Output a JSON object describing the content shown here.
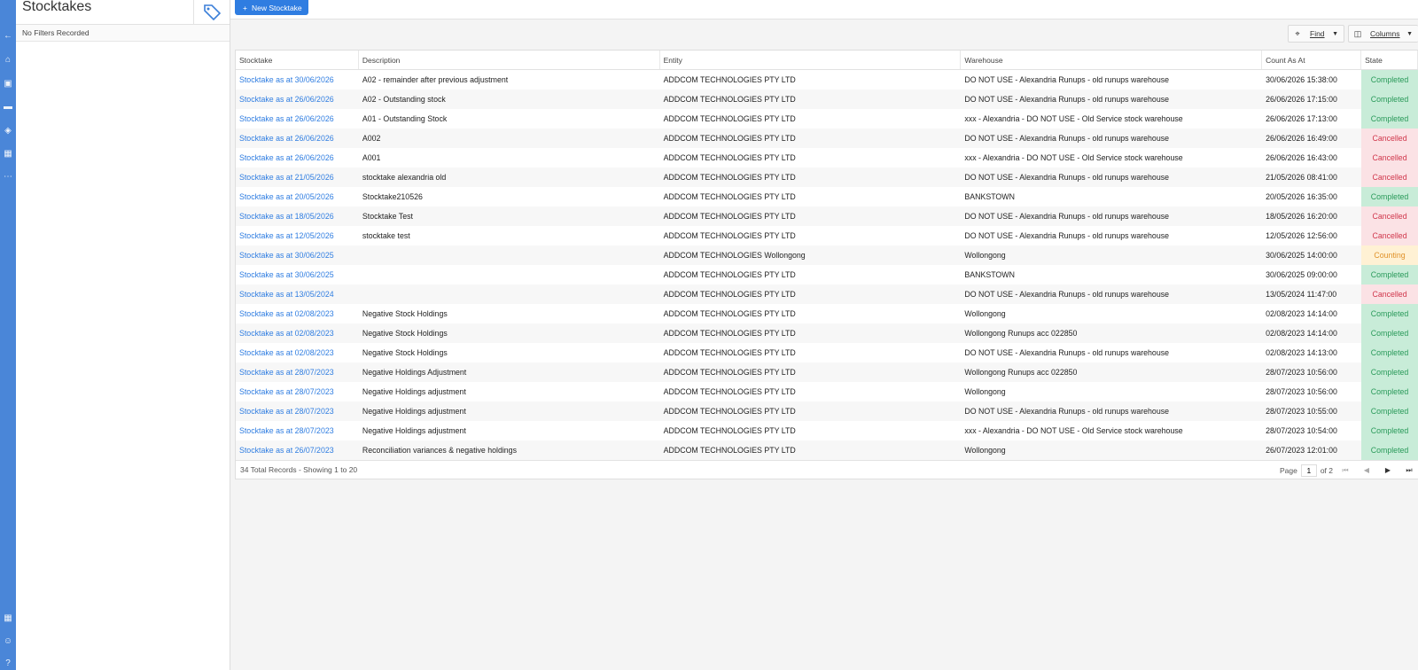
{
  "sidebar_panel": {
    "title": "Stocktakes",
    "filters_text": "No Filters Recorded"
  },
  "toolbar": {
    "new_button_label": "New Stocktake",
    "find_label": "Find",
    "columns_label": "Columns"
  },
  "table": {
    "columns": [
      "Stocktake",
      "Description",
      "Entity",
      "Warehouse",
      "Count As At",
      "State"
    ],
    "rows": [
      {
        "stocktake": "Stocktake as at 30/06/2026",
        "description": "A02 - remainder after previous adjustment",
        "entity": "ADDCOM TECHNOLOGIES PTY LTD",
        "warehouse": "DO NOT USE - Alexandria Runups - old runups warehouse",
        "count_as_at": "30/06/2026 15:38:00",
        "state": "Completed"
      },
      {
        "stocktake": "Stocktake as at 26/06/2026",
        "description": "A02 - Outstanding stock",
        "entity": "ADDCOM TECHNOLOGIES PTY LTD",
        "warehouse": "DO NOT USE - Alexandria Runups - old runups warehouse",
        "count_as_at": "26/06/2026 17:15:00",
        "state": "Completed"
      },
      {
        "stocktake": "Stocktake as at 26/06/2026",
        "description": "A01 - Outstanding Stock",
        "entity": "ADDCOM TECHNOLOGIES PTY LTD",
        "warehouse": "xxx - Alexandria - DO NOT USE - Old Service stock warehouse",
        "count_as_at": "26/06/2026 17:13:00",
        "state": "Completed"
      },
      {
        "stocktake": "Stocktake as at 26/06/2026",
        "description": "A002",
        "entity": "ADDCOM TECHNOLOGIES PTY LTD",
        "warehouse": "DO NOT USE - Alexandria Runups - old runups warehouse",
        "count_as_at": "26/06/2026 16:49:00",
        "state": "Cancelled"
      },
      {
        "stocktake": "Stocktake as at 26/06/2026",
        "description": "A001",
        "entity": "ADDCOM TECHNOLOGIES PTY LTD",
        "warehouse": "xxx - Alexandria - DO NOT USE - Old Service stock warehouse",
        "count_as_at": "26/06/2026 16:43:00",
        "state": "Cancelled"
      },
      {
        "stocktake": "Stocktake as at 21/05/2026",
        "description": "stocktake alexandria old",
        "entity": "ADDCOM TECHNOLOGIES PTY LTD",
        "warehouse": "DO NOT USE - Alexandria Runups - old runups warehouse",
        "count_as_at": "21/05/2026 08:41:00",
        "state": "Cancelled"
      },
      {
        "stocktake": "Stocktake as at 20/05/2026",
        "description": "Stocktake210526",
        "entity": "ADDCOM TECHNOLOGIES PTY LTD",
        "warehouse": "BANKSTOWN",
        "count_as_at": "20/05/2026 16:35:00",
        "state": "Completed"
      },
      {
        "stocktake": "Stocktake as at 18/05/2026",
        "description": "Stocktake Test",
        "entity": "ADDCOM TECHNOLOGIES PTY LTD",
        "warehouse": "DO NOT USE - Alexandria Runups - old runups warehouse",
        "count_as_at": "18/05/2026 16:20:00",
        "state": "Cancelled"
      },
      {
        "stocktake": "Stocktake as at 12/05/2026",
        "description": "stocktake test",
        "entity": "ADDCOM TECHNOLOGIES PTY LTD",
        "warehouse": "DO NOT USE - Alexandria Runups - old runups warehouse",
        "count_as_at": "12/05/2026 12:56:00",
        "state": "Cancelled"
      },
      {
        "stocktake": "Stocktake as at 30/06/2025",
        "description": "",
        "entity": "ADDCOM TECHNOLOGIES Wollongong",
        "warehouse": "Wollongong",
        "count_as_at": "30/06/2025 14:00:00",
        "state": "Counting"
      },
      {
        "stocktake": "Stocktake as at 30/06/2025",
        "description": "",
        "entity": "ADDCOM TECHNOLOGIES PTY LTD",
        "warehouse": "BANKSTOWN",
        "count_as_at": "30/06/2025 09:00:00",
        "state": "Completed"
      },
      {
        "stocktake": "Stocktake as at 13/05/2024",
        "description": "",
        "entity": "ADDCOM TECHNOLOGIES PTY LTD",
        "warehouse": "DO NOT USE - Alexandria Runups - old runups warehouse",
        "count_as_at": "13/05/2024 11:47:00",
        "state": "Cancelled"
      },
      {
        "stocktake": "Stocktake as at 02/08/2023",
        "description": "Negative Stock Holdings",
        "entity": "ADDCOM TECHNOLOGIES PTY LTD",
        "warehouse": "Wollongong",
        "count_as_at": "02/08/2023 14:14:00",
        "state": "Completed"
      },
      {
        "stocktake": "Stocktake as at 02/08/2023",
        "description": "Negative Stock Holdings",
        "entity": "ADDCOM TECHNOLOGIES PTY LTD",
        "warehouse": "Wollongong Runups acc 022850",
        "count_as_at": "02/08/2023 14:14:00",
        "state": "Completed"
      },
      {
        "stocktake": "Stocktake as at 02/08/2023",
        "description": "Negative Stock Holdings",
        "entity": "ADDCOM TECHNOLOGIES PTY LTD",
        "warehouse": "DO NOT USE - Alexandria Runups - old runups warehouse",
        "count_as_at": "02/08/2023 14:13:00",
        "state": "Completed"
      },
      {
        "stocktake": "Stocktake as at 28/07/2023",
        "description": "Negative Holdings Adjustment",
        "entity": "ADDCOM TECHNOLOGIES PTY LTD",
        "warehouse": "Wollongong Runups acc 022850",
        "count_as_at": "28/07/2023 10:56:00",
        "state": "Completed"
      },
      {
        "stocktake": "Stocktake as at 28/07/2023",
        "description": "Negative Holdings adjustment",
        "entity": "ADDCOM TECHNOLOGIES PTY LTD",
        "warehouse": "Wollongong",
        "count_as_at": "28/07/2023 10:56:00",
        "state": "Completed"
      },
      {
        "stocktake": "Stocktake as at 28/07/2023",
        "description": "Negative Holdings adjustment",
        "entity": "ADDCOM TECHNOLOGIES PTY LTD",
        "warehouse": "DO NOT USE - Alexandria Runups - old runups warehouse",
        "count_as_at": "28/07/2023 10:55:00",
        "state": "Completed"
      },
      {
        "stocktake": "Stocktake as at 28/07/2023",
        "description": "Negative Holdings adjustment",
        "entity": "ADDCOM TECHNOLOGIES PTY LTD",
        "warehouse": "xxx - Alexandria - DO NOT USE - Old Service stock warehouse",
        "count_as_at": "28/07/2023 10:54:00",
        "state": "Completed"
      },
      {
        "stocktake": "Stocktake as at 26/07/2023",
        "description": "Reconciliation variances & negative holdings",
        "entity": "ADDCOM TECHNOLOGIES PTY LTD",
        "warehouse": "Wollongong",
        "count_as_at": "26/07/2023 12:01:00",
        "state": "Completed"
      }
    ]
  },
  "footer": {
    "summary": "34 Total Records - Showing 1 to 20",
    "page_label": "Page",
    "page_value": "1",
    "of_label": "of 2"
  },
  "colors": {
    "accent": "#2f7de1",
    "rail": "#4a86d8",
    "completed": "#2a9a5a",
    "cancelled": "#d0364b",
    "counting": "#e0922a"
  }
}
